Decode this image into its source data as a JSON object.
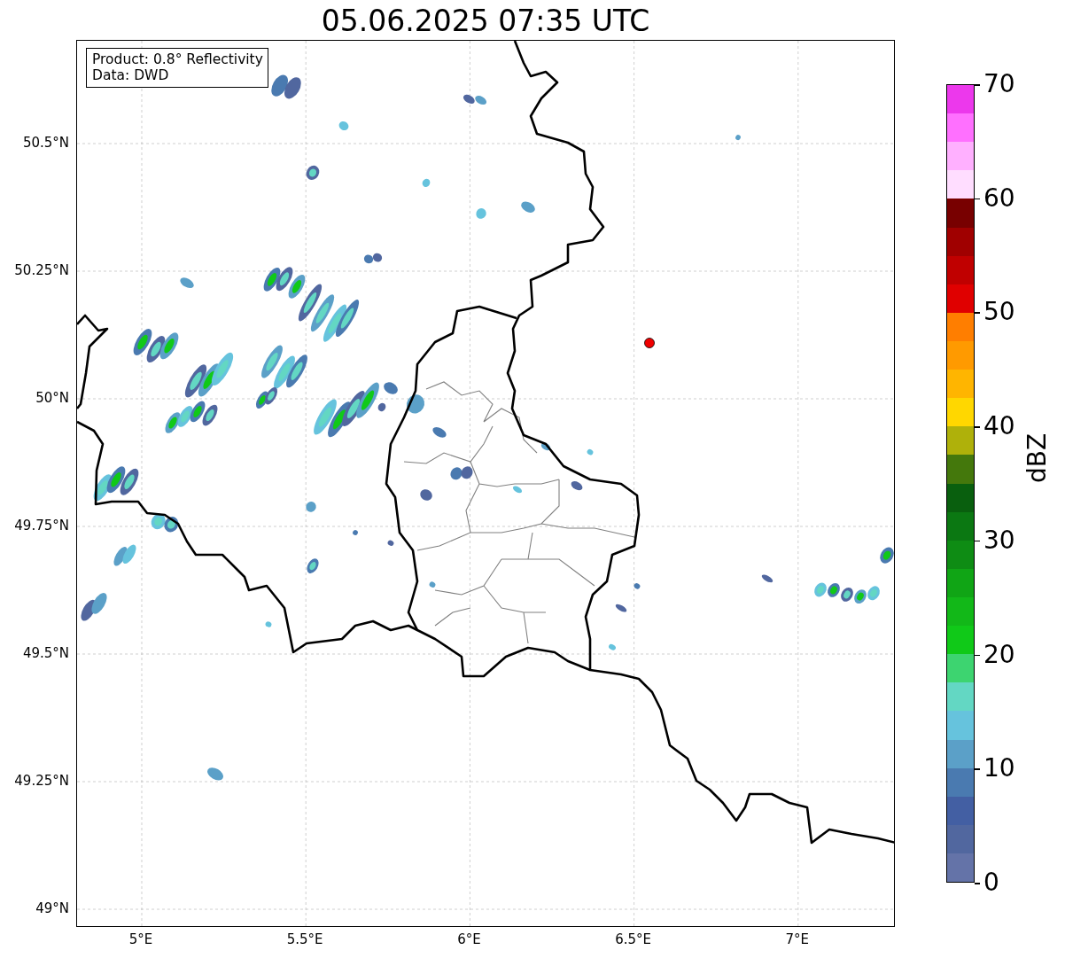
{
  "title": "05.06.2025 07:35 UTC",
  "info_box": {
    "lines": [
      "Product: 0.8° Reflectivity",
      "Data: DWD"
    ]
  },
  "map": {
    "lat_labels": [
      "50.5°N",
      "50.25°N",
      "50°N",
      "49.75°N",
      "49.5°N",
      "49.25°N",
      "49°N"
    ],
    "lon_labels": [
      "5°E",
      "5.5°E",
      "6°E",
      "6.5°E",
      "7°E"
    ]
  },
  "colorbar": {
    "label": "dBZ",
    "ticks": [
      "70",
      "60",
      "50",
      "40",
      "30",
      "20",
      "10",
      "0"
    ],
    "bins": [
      {
        "color": "#ec38ec"
      },
      {
        "color": "#ff70ff"
      },
      {
        "color": "#ffb0ff"
      },
      {
        "color": "#ffddff"
      },
      {
        "color": "#780000"
      },
      {
        "color": "#a00000"
      },
      {
        "color": "#c00000"
      },
      {
        "color": "#e00000"
      },
      {
        "color": "#ff7e00"
      },
      {
        "color": "#ff9a00"
      },
      {
        "color": "#ffb500"
      },
      {
        "color": "#ffd700"
      },
      {
        "color": "#afb10a"
      },
      {
        "color": "#44780c"
      },
      {
        "color": "#095f0e"
      },
      {
        "color": "#0b7812"
      },
      {
        "color": "#0e8c14"
      },
      {
        "color": "#10a515"
      },
      {
        "color": "#12b818"
      },
      {
        "color": "#10c918"
      },
      {
        "color": "#3dd470"
      },
      {
        "color": "#63d7c3"
      },
      {
        "color": "#66c3dd"
      },
      {
        "color": "#5ba0c8"
      },
      {
        "color": "#4a7ab0"
      },
      {
        "color": "#435fa3"
      },
      {
        "color": "#51679f"
      },
      {
        "color": "#6473a8"
      }
    ]
  }
}
